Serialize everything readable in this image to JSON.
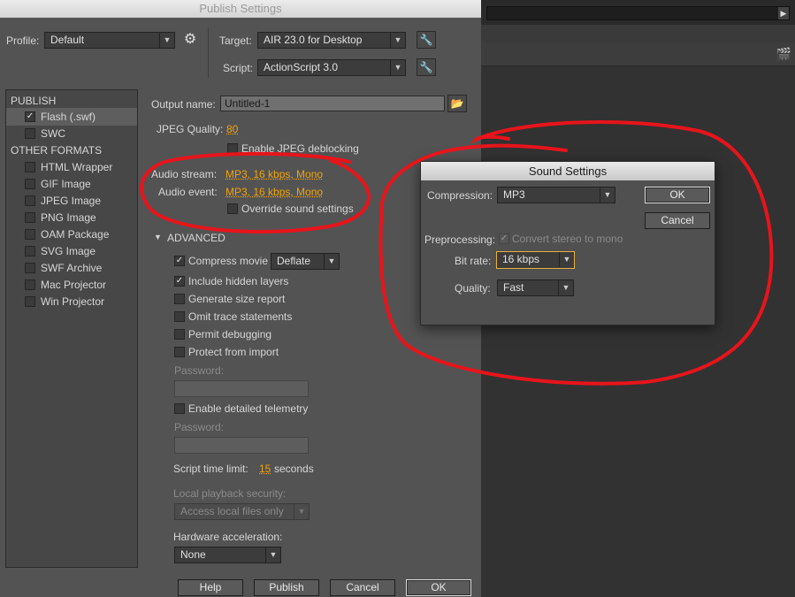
{
  "dialog_title": "Publish Settings",
  "profile": {
    "label": "Profile:",
    "value": "Default"
  },
  "target": {
    "label": "Target:",
    "value": "AIR 23.0 for Desktop"
  },
  "script": {
    "label": "Script:",
    "value": "ActionScript 3.0"
  },
  "publish": {
    "header": "PUBLISH",
    "items": [
      {
        "label": "Flash (.swf)",
        "checked": true
      },
      {
        "label": "SWC",
        "checked": false
      }
    ]
  },
  "other_formats": {
    "header": "OTHER FORMATS",
    "items": [
      {
        "label": "HTML Wrapper"
      },
      {
        "label": "GIF Image"
      },
      {
        "label": "JPEG Image"
      },
      {
        "label": "PNG Image"
      },
      {
        "label": "OAM Package"
      },
      {
        "label": "SVG Image"
      },
      {
        "label": "SWF Archive"
      },
      {
        "label": "Mac Projector"
      },
      {
        "label": "Win Projector"
      }
    ]
  },
  "output": {
    "label": "Output name:",
    "value": "Untitled-1"
  },
  "jpeg": {
    "label": "JPEG Quality:",
    "value": "80",
    "deblock_label": "Enable JPEG deblocking"
  },
  "audio": {
    "stream_label": "Audio stream:",
    "stream_value": "MP3, 16 kbps, Mono",
    "event_label": "Audio event:",
    "event_value": "MP3, 16 kbps, Mono",
    "override_label": "Override sound settings"
  },
  "advanced": {
    "header": "ADVANCED",
    "compress_label": "Compress movie",
    "compress_value": "Deflate",
    "include_hidden": "Include hidden layers",
    "size_report": "Generate size report",
    "omit_trace": "Omit trace statements",
    "permit_debug": "Permit debugging",
    "protect_import": "Protect from import",
    "password_label": "Password:",
    "telemetry": "Enable detailed telemetry",
    "password2_label": "Password:",
    "script_time_label": "Script time limit:",
    "script_time_value": "15",
    "script_time_unit": "seconds",
    "local_security_label": "Local playback security:",
    "local_security_value": "Access local files only",
    "hw_accel_label": "Hardware acceleration:",
    "hw_accel_value": "None"
  },
  "footer": {
    "help": "Help",
    "publish": "Publish",
    "cancel": "Cancel",
    "ok": "OK"
  },
  "sound": {
    "title": "Sound Settings",
    "compression_label": "Compression:",
    "compression_value": "MP3",
    "ok": "OK",
    "cancel": "Cancel",
    "preprocessing_label": "Preprocessing:",
    "preprocessing_value": "Convert stereo to mono",
    "bitrate_label": "Bit rate:",
    "bitrate_value": "16 kbps",
    "quality_label": "Quality:",
    "quality_value": "Fast"
  },
  "colors": {
    "accent": "#f0a30a",
    "annotation": "#e8141b"
  }
}
